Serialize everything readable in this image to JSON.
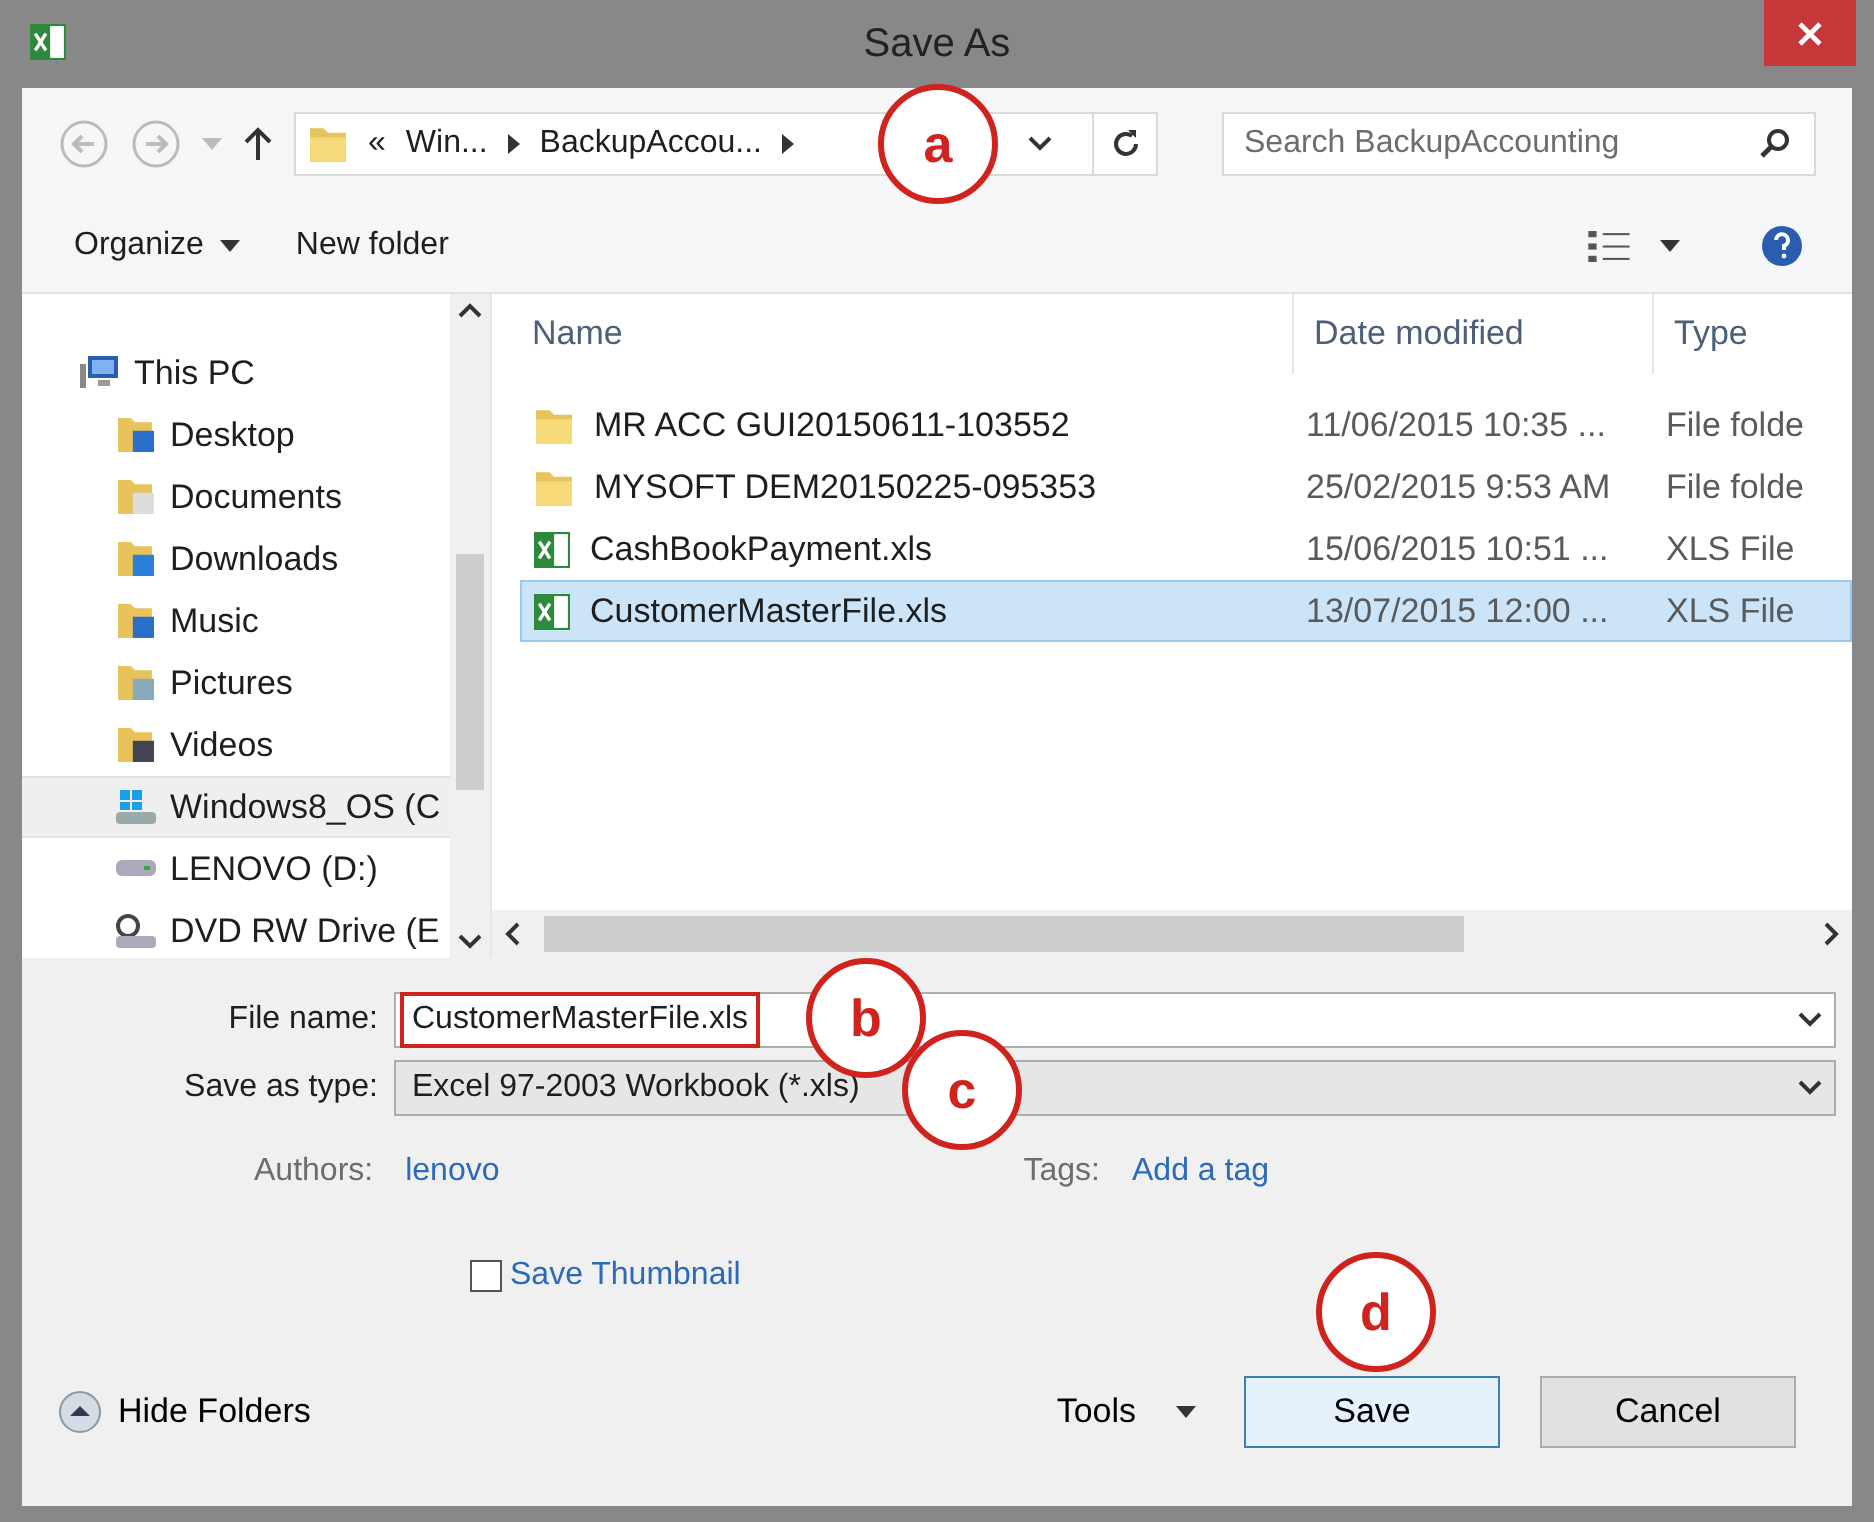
{
  "window": {
    "title": "Save As"
  },
  "address": {
    "crumbs": [
      "«",
      "Win...",
      "BackupAccou..."
    ],
    "callout": "a"
  },
  "search": {
    "placeholder": "Search BackupAccounting"
  },
  "toolbar": {
    "buttons": [
      "Organize",
      "New folder"
    ]
  },
  "nav": {
    "items": [
      {
        "label": "This PC",
        "kind": "pc",
        "selected": false,
        "children": [
          {
            "label": "Desktop",
            "kind": "desktop",
            "selected": false
          },
          {
            "label": "Documents",
            "kind": "documents",
            "selected": false
          },
          {
            "label": "Downloads",
            "kind": "downloads",
            "selected": false
          },
          {
            "label": "Music",
            "kind": "music",
            "selected": false
          },
          {
            "label": "Pictures",
            "kind": "pictures",
            "selected": false
          },
          {
            "label": "Videos",
            "kind": "videos",
            "selected": false
          },
          {
            "label": "Windows8_OS (C",
            "kind": "windrive",
            "selected": true
          },
          {
            "label": "LENOVO (D:)",
            "kind": "drive",
            "selected": false
          },
          {
            "label": "DVD RW Drive (E",
            "kind": "dvd",
            "selected": false
          }
        ]
      }
    ]
  },
  "files": {
    "columns": [
      "Name",
      "Date modified",
      "Type"
    ],
    "rows": [
      {
        "name": "MR ACC GUI20150611-103552",
        "date": "11/06/2015 10:35 ...",
        "type": "File folde",
        "kind": "folder",
        "selected": false
      },
      {
        "name": "MYSOFT DEM20150225-095353",
        "date": "25/02/2015 9:53 AM",
        "type": "File folde",
        "kind": "folder",
        "selected": false
      },
      {
        "name": "CashBookPayment.xls",
        "date": "15/06/2015 10:51 ...",
        "type": "XLS File",
        "kind": "xls",
        "selected": false
      },
      {
        "name": "CustomerMasterFile.xls",
        "date": "13/07/2015 12:00 ...",
        "type": "XLS File",
        "kind": "xls",
        "selected": true
      }
    ]
  },
  "form": {
    "file_name": {
      "label": "File name:",
      "value": "CustomerMasterFile.xls",
      "callout": "b"
    },
    "save_type": {
      "label": "Save as type:",
      "value": "Excel 97-2003 Workbook (*.xls)",
      "callout": "c"
    },
    "authors": {
      "label": "Authors:",
      "value": "lenovo"
    },
    "tags": {
      "label": "Tags:",
      "value": "Add a tag"
    },
    "thumbnail": {
      "label": "Save Thumbnail",
      "checked": false
    }
  },
  "footer": {
    "hide_folders": "Hide Folders",
    "tools": "Tools",
    "save": {
      "label": "Save",
      "callout": "d"
    },
    "cancel": "Cancel"
  }
}
